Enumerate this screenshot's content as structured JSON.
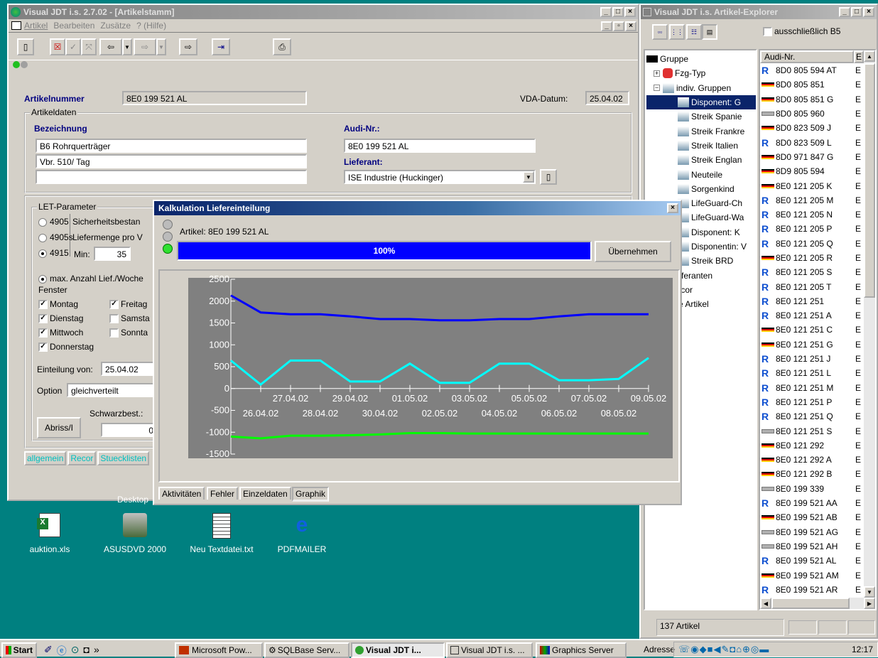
{
  "main_window": {
    "title": "Visual JDT i.s. 2.7.02 - [Artikelstamm]",
    "menu": [
      "Artikel",
      "Bearbeiten",
      "Zusätze",
      "? (Hilfe)"
    ],
    "artikelnummer_label": "Artikelnummer",
    "artikelnummer": "8E0 199 521 AL",
    "vda_label": "VDA-Datum:",
    "vda_datum": "25.04.02",
    "artikeldaten_label": "Artikeldaten",
    "bezeichnung_label": "Bezeichnung",
    "bezeichnung1": "B6 Rohrquerträger",
    "bezeichnung2": "Vbr. 510/ Tag",
    "audi_label": "Audi-Nr.:",
    "audi_nr": "8E0 199 521 AL",
    "lieferant_label": "Lieferant:",
    "lieferant": "ISE Industrie (Huckinger)",
    "let_label": "LET-Parameter",
    "radios": [
      {
        "code": "4905",
        "text": "Sicherheitsbestan",
        "on": false
      },
      {
        "code": "4905s",
        "text": "Liefermenge pro V",
        "on": false
      },
      {
        "code": "4915",
        "text": "Min:",
        "on": true
      }
    ],
    "min_value": "35",
    "max_anzahl": "max. Anzahl Lief./Woche",
    "fenster_label": "Fenster",
    "days_left": [
      {
        "label": "Montag",
        "checked": true
      },
      {
        "label": "Dienstag",
        "checked": true
      },
      {
        "label": "Mittwoch",
        "checked": true
      },
      {
        "label": "Donnerstag",
        "checked": true
      }
    ],
    "days_right": [
      {
        "label": "Freitag",
        "checked": true
      },
      {
        "label": "Samsta",
        "checked": false
      },
      {
        "label": "Sonnta",
        "checked": false
      }
    ],
    "einteilung_label": "Einteilung von:",
    "einteilung_von": "25.04.02",
    "option_label": "Option",
    "option_value": "gleichverteilt",
    "schwarzbest_label": "Schwarzbest.:",
    "schwarzbest_value": "0",
    "abriss_label": "Abriss/I",
    "bottom_tabs": [
      "allgemein",
      "Recor",
      "Stuecklisten"
    ]
  },
  "dialog": {
    "title": "Kalkulation Liefereinteilung",
    "artikel_line": "Artikel: 8E0 199 521 AL",
    "progress": 1.0,
    "progress_text": "100%",
    "uebernehmen": "Übernehmen",
    "tabs": [
      "Aktivitäten",
      "Fehler",
      "Einzeldaten",
      "Graphik"
    ],
    "active_tab": "Graphik"
  },
  "chart_data": {
    "type": "line",
    "title": "",
    "xlabel": "",
    "ylabel": "",
    "x": [
      "26.04.02",
      "27.04.02",
      "28.04.02",
      "29.04.02",
      "30.04.02",
      "01.05.02",
      "02.05.02",
      "03.05.02",
      "04.05.02",
      "05.05.02",
      "06.05.02",
      "07.05.02",
      "08.05.02",
      "09.05.02"
    ],
    "ylim": [
      -1500,
      2500
    ],
    "yticks": [
      2500,
      2000,
      1500,
      1000,
      500,
      0,
      -500,
      -1000,
      -1500
    ],
    "series": [
      {
        "color": "#0000ff",
        "values": [
          2130,
          1740,
          1700,
          1700,
          1650,
          1590,
          1590,
          1560,
          1560,
          1590,
          1590,
          1650,
          1700,
          1700,
          1700
        ]
      },
      {
        "color": "#00ffff",
        "values": [
          640,
          90,
          640,
          640,
          160,
          160,
          570,
          130,
          130,
          570,
          570,
          190,
          190,
          220,
          700
        ]
      },
      {
        "color": "#00ff00",
        "values": [
          -1100,
          -1140,
          -1080,
          -1080,
          -1070,
          -1050,
          -1020,
          -1020,
          -1030,
          -1030,
          -1030,
          -1030,
          -1030,
          -1030,
          -1030
        ]
      }
    ]
  },
  "explorer": {
    "title": "Visual JDT i.s.  Artikel-Explorer",
    "checkbox_label": "ausschließlich B5",
    "tree_root": "Gruppe",
    "tree": [
      "Fzg-Typ",
      "indiv. Gruppen",
      "Disponent: G",
      "Streik Spanie",
      "Streik Frankre",
      "Streik Italien",
      "Streik Englan",
      "Neuteile",
      "Sorgenkind",
      "LifeGuard-Ch",
      "LifeGuard-Wa",
      "Disponent: K",
      "Disponentin: V",
      "Streik BRD",
      "Lieferanten",
      "Recor",
      "alle Artikel"
    ],
    "list_header": "Audi-Nr.",
    "list_header2": "E",
    "items": [
      {
        "nr": "8D0 805 594 AT",
        "icon": "r"
      },
      {
        "nr": "8D0 805 851",
        "icon": "de"
      },
      {
        "nr": "8D0 805 851 G",
        "icon": "de"
      },
      {
        "nr": "8D0 805 960",
        "icon": "gray"
      },
      {
        "nr": "8D0 823 509 J",
        "icon": "de"
      },
      {
        "nr": "8D0 823 509 L",
        "icon": "r"
      },
      {
        "nr": "8D0 971 847 G",
        "icon": "de"
      },
      {
        "nr": "8D9 805 594",
        "icon": "de"
      },
      {
        "nr": "8E0 121 205 K",
        "icon": "de"
      },
      {
        "nr": "8E0 121 205 M",
        "icon": "r"
      },
      {
        "nr": "8E0 121 205 N",
        "icon": "r"
      },
      {
        "nr": "8E0 121 205 P",
        "icon": "r"
      },
      {
        "nr": "8E0 121 205 Q",
        "icon": "r"
      },
      {
        "nr": "8E0 121 205 R",
        "icon": "de"
      },
      {
        "nr": "8E0 121 205 S",
        "icon": "r"
      },
      {
        "nr": "8E0 121 205 T",
        "icon": "r"
      },
      {
        "nr": "8E0 121 251",
        "icon": "r"
      },
      {
        "nr": "8E0 121 251 A",
        "icon": "r"
      },
      {
        "nr": "8E0 121 251 C",
        "icon": "de"
      },
      {
        "nr": "8E0 121 251 G",
        "icon": "de"
      },
      {
        "nr": "8E0 121 251 J",
        "icon": "r"
      },
      {
        "nr": "8E0 121 251 L",
        "icon": "r"
      },
      {
        "nr": "8E0 121 251 M",
        "icon": "r"
      },
      {
        "nr": "8E0 121 251 P",
        "icon": "r"
      },
      {
        "nr": "8E0 121 251 Q",
        "icon": "r"
      },
      {
        "nr": "8E0 121 251 S",
        "icon": "gray"
      },
      {
        "nr": "8E0 121 292",
        "icon": "de"
      },
      {
        "nr": "8E0 121 292 A",
        "icon": "de"
      },
      {
        "nr": "8E0 121 292 B",
        "icon": "de"
      },
      {
        "nr": "8E0 199 339",
        "icon": "gray"
      },
      {
        "nr": "8E0 199 521 AA",
        "icon": "r"
      },
      {
        "nr": "8E0 199 521 AB",
        "icon": "de"
      },
      {
        "nr": "8E0 199 521 AG",
        "icon": "gray"
      },
      {
        "nr": "8E0 199 521 AH",
        "icon": "gray"
      },
      {
        "nr": "8E0 199 521 AL",
        "icon": "r"
      },
      {
        "nr": "8E0 199 521 AM",
        "icon": "de"
      },
      {
        "nr": "8E0 199 521 AR",
        "icon": "r"
      }
    ],
    "col2": "E",
    "status": "137 Artikel"
  },
  "desktop": {
    "label": "Desktop",
    "icons": [
      {
        "label": "auktion.xls"
      },
      {
        "label": "ASUSDVD 2000"
      },
      {
        "label": "Neu Textdatei.txt"
      },
      {
        "label": "PDFMAILER"
      }
    ]
  },
  "taskbar": {
    "start": "Start",
    "quick": "»",
    "items": [
      "Microsoft Pow...",
      "SQLBase Serv...",
      "Visual JDT i...",
      "Visual JDT i.s. ...",
      "Graphics Server"
    ],
    "address": "Adresse",
    "clock": "12:17"
  }
}
